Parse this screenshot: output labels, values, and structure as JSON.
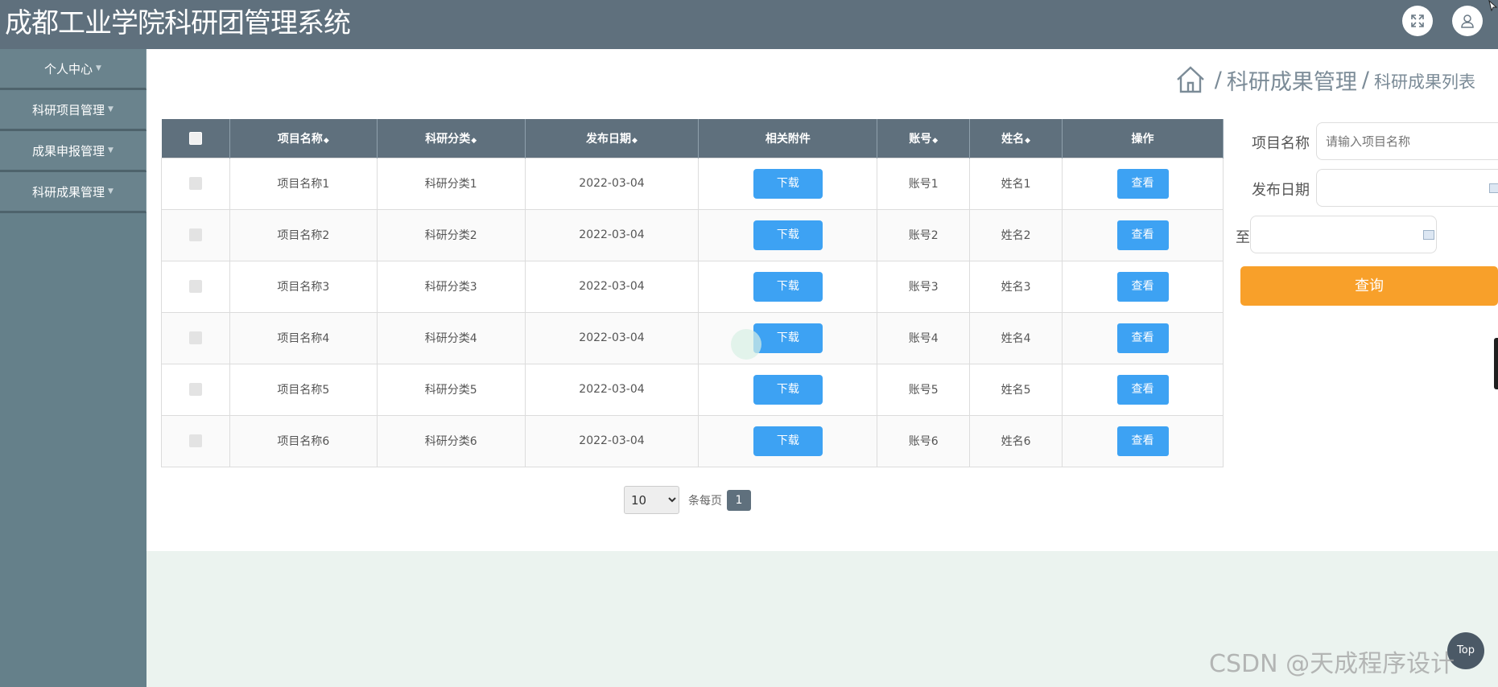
{
  "header": {
    "title": "成都工业学院科研团管理系统"
  },
  "sidebar": {
    "items": [
      {
        "label": "个人中心"
      },
      {
        "label": "科研项目管理"
      },
      {
        "label": "成果申报管理"
      },
      {
        "label": "科研成果管理"
      }
    ]
  },
  "breadcrumb": {
    "section": "科研成果管理",
    "separator": "/",
    "page": "科研成果列表"
  },
  "table": {
    "columns": [
      "项目名称",
      "科研分类",
      "发布日期",
      "相关附件",
      "账号",
      "姓名",
      "操作"
    ],
    "rows": [
      {
        "name": "项目名称1",
        "category": "科研分类1",
        "date": "2022-03-04",
        "attach": "下载",
        "account": "账号1",
        "person": "姓名1",
        "action": "查看"
      },
      {
        "name": "项目名称2",
        "category": "科研分类2",
        "date": "2022-03-04",
        "attach": "下载",
        "account": "账号2",
        "person": "姓名2",
        "action": "查看"
      },
      {
        "name": "项目名称3",
        "category": "科研分类3",
        "date": "2022-03-04",
        "attach": "下载",
        "account": "账号3",
        "person": "姓名3",
        "action": "查看"
      },
      {
        "name": "项目名称4",
        "category": "科研分类4",
        "date": "2022-03-04",
        "attach": "下载",
        "account": "账号4",
        "person": "姓名4",
        "action": "查看"
      },
      {
        "name": "项目名称5",
        "category": "科研分类5",
        "date": "2022-03-04",
        "attach": "下载",
        "account": "账号5",
        "person": "姓名5",
        "action": "查看"
      },
      {
        "name": "项目名称6",
        "category": "科研分类6",
        "date": "2022-03-04",
        "attach": "下载",
        "account": "账号6",
        "person": "姓名6",
        "action": "查看"
      }
    ]
  },
  "pagination": {
    "page_size": "10",
    "page_size_options": [
      "10"
    ],
    "per_page_label": "条每页",
    "current_page": "1"
  },
  "search": {
    "name_label": "项目名称",
    "name_placeholder": "请输入项目名称",
    "date_label": "发布日期",
    "to_label": "至",
    "query_button": "查询"
  },
  "back_to_top": "Top",
  "watermark": "CSDN @天成程序设计",
  "colors": {
    "header": "#5f707d",
    "sidebar": "#65808a",
    "primary_button": "#3da2f3",
    "query_button": "#f8a02a",
    "footer_bg": "#ebf3ef"
  },
  "icons": [
    "fullscreen-icon",
    "user-icon",
    "home-icon",
    "calendar-icon",
    "sort-icon",
    "checkbox"
  ]
}
